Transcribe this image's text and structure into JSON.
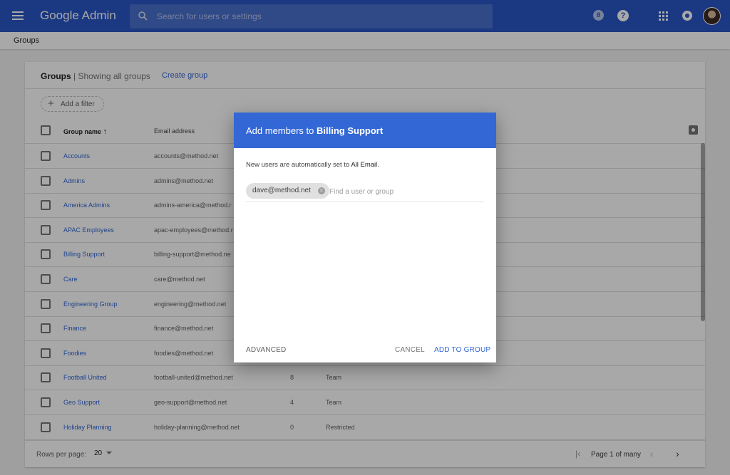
{
  "topbar": {
    "brand": "Google Admin",
    "search_placeholder": "Search for users or settings",
    "badge_label": "8",
    "help_label": "?"
  },
  "breadcrumb": {
    "label": "Groups"
  },
  "groups_card": {
    "title": "Groups",
    "subtitle": "| Showing all groups",
    "create_link": "Create group",
    "filter_label": "Add a filter",
    "columns": {
      "name": "Group name",
      "email": "Email address"
    },
    "rows": [
      {
        "name": "Accounts",
        "email": "accounts@method.net",
        "members": "",
        "access": ""
      },
      {
        "name": "Admins",
        "email": "admins@method.net",
        "members": "",
        "access": ""
      },
      {
        "name": "America Admins",
        "email": "admins-america@method.r",
        "members": "",
        "access": ""
      },
      {
        "name": "APAC Employees",
        "email": "apac-employees@method.r",
        "members": "",
        "access": ""
      },
      {
        "name": "Billing Support",
        "email": "billing-support@method.ne",
        "members": "",
        "access": ""
      },
      {
        "name": "Care",
        "email": "care@method.net",
        "members": "",
        "access": ""
      },
      {
        "name": "Engineering Group",
        "email": "engineering@method.net",
        "members": "",
        "access": ""
      },
      {
        "name": "Finance",
        "email": "finance@method.net",
        "members": "",
        "access": ""
      },
      {
        "name": "Foodies",
        "email": "foodies@method.net",
        "members": "",
        "access": ""
      },
      {
        "name": "Football United",
        "email": "football-united@method.net",
        "members": "8",
        "access": "Team"
      },
      {
        "name": "Geo Support",
        "email": "geo-support@method.net",
        "members": "4",
        "access": "Team"
      },
      {
        "name": "Holiday Planning",
        "email": "holiday-planning@method.net",
        "members": "0",
        "access": "Restricted"
      }
    ],
    "footer": {
      "rows_per_page_label": "Rows per page:",
      "rows_per_page_value": "20",
      "page_info": "Page 1 of many"
    }
  },
  "dialog": {
    "title_prefix": "Add members to",
    "group_name": "Billing Support",
    "info_prefix": "New users are automatically set to",
    "info_value": "All Email",
    "info_suffix": ".",
    "chip_label": "dave@method.net",
    "input_placeholder": "Find a user or group",
    "advanced_label": "ADVANCED",
    "cancel_label": "CANCEL",
    "add_label": "ADD TO GROUP"
  },
  "colors": {
    "header_blue": "#2a56c6",
    "dialog_blue": "#3367d6",
    "link_blue": "#3367d6"
  }
}
